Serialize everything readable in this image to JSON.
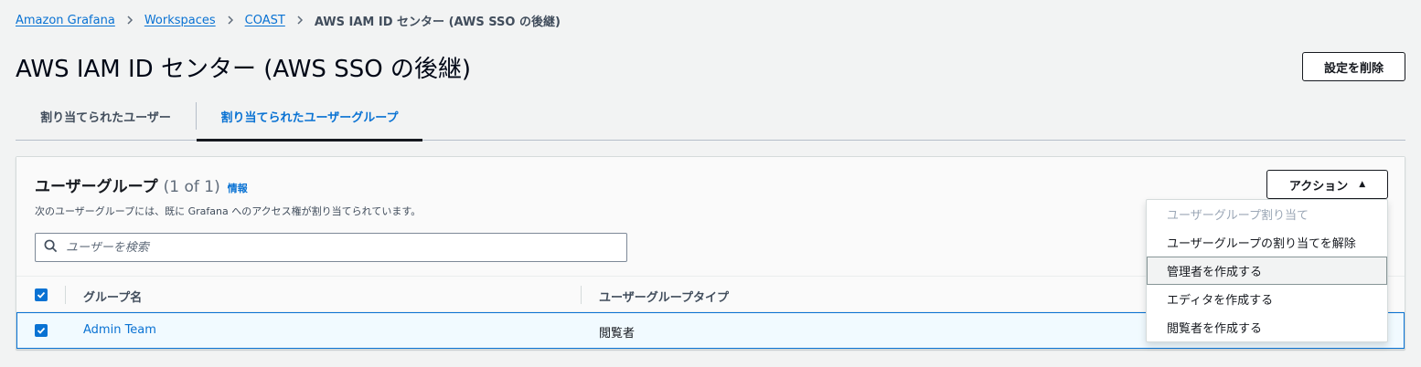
{
  "breadcrumb": {
    "items": [
      "Amazon Grafana",
      "Workspaces",
      "COAST"
    ],
    "current": "AWS IAM ID センター (AWS SSO の後継)"
  },
  "page": {
    "title": "AWS IAM ID センター (AWS SSO の後継)",
    "delete_button": "設定を削除"
  },
  "tabs": [
    {
      "label": "割り当てられたユーザー",
      "active": false
    },
    {
      "label": "割り当てられたユーザーグループ",
      "active": true
    }
  ],
  "panel": {
    "title": "ユーザーグループ",
    "count": "(1 of 1)",
    "info": "情報",
    "description": "次のユーザーグループには、既に Grafana へのアクセス権が割り当てられています。",
    "actions_button": "アクション",
    "search_placeholder": "ユーザーを検索"
  },
  "table": {
    "columns": [
      "グループ名",
      "ユーザーグループタイプ"
    ],
    "rows": [
      {
        "name": "Admin Team",
        "type": "閲覧者",
        "selected": true
      }
    ]
  },
  "actions_menu": {
    "items": [
      {
        "label": "ユーザーグループ割り当て",
        "disabled": true
      },
      {
        "label": "ユーザーグループの割り当てを解除",
        "disabled": false
      },
      {
        "label": "管理者を作成する",
        "disabled": false,
        "hovered": true
      },
      {
        "label": "エディタを作成する",
        "disabled": false
      },
      {
        "label": "閲覧者を作成する",
        "disabled": false
      }
    ]
  },
  "colors": {
    "link": "#0972d3",
    "background": "#f2f3f3",
    "selected_row": "#f1faff"
  }
}
